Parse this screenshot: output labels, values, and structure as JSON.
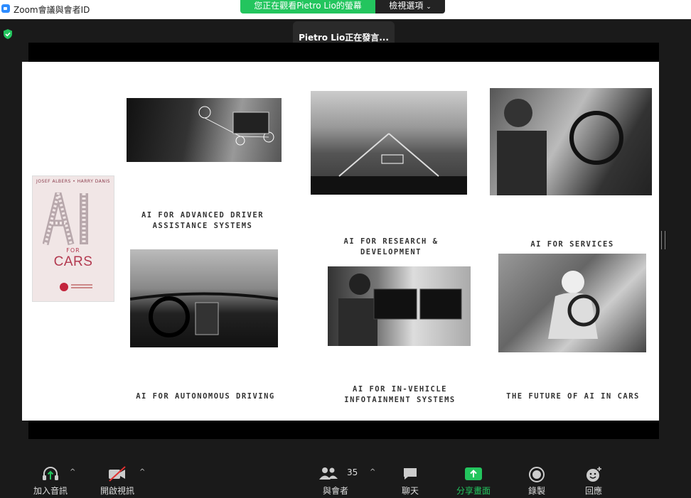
{
  "window": {
    "title": "Zoom會議與會者ID"
  },
  "banner": {
    "viewing": "您正在觀看Pietro Lio的螢幕",
    "view_options": "檢視選項",
    "chevron": "⌄"
  },
  "speaker": {
    "text": "Pietro Lio正在發言..."
  },
  "slide": {
    "book": {
      "authors": "JOSEF ALBERS • HARRY DANIS",
      "for": "FOR",
      "cars": "CARS"
    },
    "captions": {
      "adas": [
        "AI FOR ADVANCED DRIVER",
        "ASSISTANCE SYSTEMS"
      ],
      "rnd": [
        "AI FOR RESEARCH &",
        "DEVELOPMENT"
      ],
      "services": [
        "AI FOR SERVICES"
      ],
      "autonomous": [
        "AI FOR AUTONOMOUS DRIVING"
      ],
      "infotainment": [
        "AI FOR IN-VEHICLE",
        "INFOTAINMENT SYSTEMS"
      ],
      "future": [
        "THE FUTURE OF AI IN CARS"
      ]
    }
  },
  "toolbar": {
    "audio": "加入音訊",
    "video": "開啟視訊",
    "participants": "與會者",
    "participants_count": "35",
    "chat": "聊天",
    "share": "分享畫面",
    "record": "錄製",
    "reactions": "回應",
    "caret": "^"
  },
  "colors": {
    "share_green": "#23c55e",
    "zoom_blue": "#2d8cff",
    "toolbar_bg": "#1a1a1a"
  },
  "icons": [
    "headphones-icon",
    "video-off-icon",
    "participants-icon",
    "chat-icon",
    "share-screen-icon",
    "record-icon",
    "reaction-icon",
    "shield-icon"
  ]
}
